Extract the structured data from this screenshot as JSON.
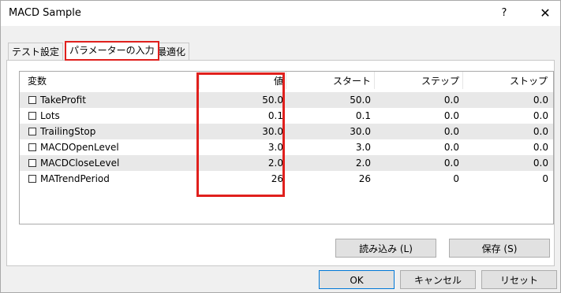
{
  "window": {
    "title": "MACD Sample",
    "help_glyph": "?",
    "close_glyph": "✕"
  },
  "tabs": [
    {
      "label": "テスト設定",
      "active": false
    },
    {
      "label": "パラメーターの入力",
      "active": true
    },
    {
      "label": "最適化",
      "active": false
    }
  ],
  "table": {
    "headers": {
      "name": "変数",
      "value": "値",
      "start": "スタート",
      "step": "ステップ",
      "stop": "ストップ"
    },
    "rows": [
      {
        "name": "TakeProfit",
        "value": "50.0",
        "start": "50.0",
        "step": "0.0",
        "stop": "0.0",
        "checked": false
      },
      {
        "name": "Lots",
        "value": "0.1",
        "start": "0.1",
        "step": "0.0",
        "stop": "0.0",
        "checked": false
      },
      {
        "name": "TrailingStop",
        "value": "30.0",
        "start": "30.0",
        "step": "0.0",
        "stop": "0.0",
        "checked": false
      },
      {
        "name": "MACDOpenLevel",
        "value": "3.0",
        "start": "3.0",
        "step": "0.0",
        "stop": "0.0",
        "checked": false
      },
      {
        "name": "MACDCloseLevel",
        "value": "2.0",
        "start": "2.0",
        "step": "0.0",
        "stop": "0.0",
        "checked": false
      },
      {
        "name": "MATrendPeriod",
        "value": "26",
        "start": "26",
        "step": "0",
        "stop": "0",
        "checked": false
      }
    ]
  },
  "buttons": {
    "load": "読み込み (L)",
    "save": "保存 (S)",
    "ok": "OK",
    "cancel": "キャンセル",
    "reset": "リセット"
  },
  "colors": {
    "highlight": "#e0201d",
    "default_button_border": "#0078d7",
    "row_alt": "#e8e8e8"
  }
}
